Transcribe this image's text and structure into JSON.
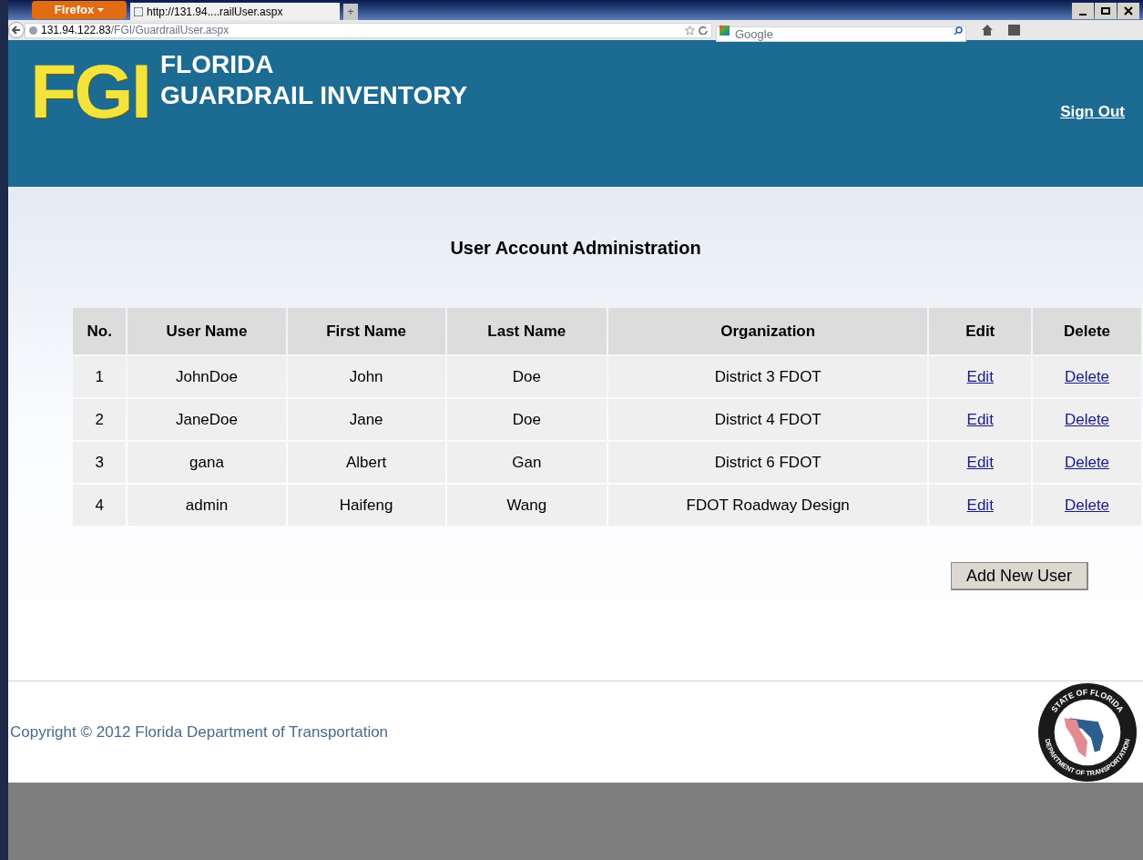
{
  "browser": {
    "menu_button": "Firefox",
    "tab": {
      "title": "http://131.94....railUser.aspx",
      "selected": true
    },
    "new_tab": "+",
    "address": {
      "host": "131.94.122.83",
      "path": "/FGI/GuardrailUser.aspx"
    },
    "search": {
      "placeholder": "Google"
    }
  },
  "header": {
    "logo": "FGI",
    "title_line_1": "FLORIDA",
    "title_line_2": "GUARDRAIL INVENTORY",
    "sign_out": "Sign Out"
  },
  "page_title": "User Account Administration",
  "table": {
    "columns": [
      "No.",
      "User Name",
      "First Name",
      "Last Name",
      "Organization",
      "Edit",
      "Delete"
    ],
    "rows": [
      {
        "no": "1",
        "user_name": "JohnDoe",
        "first_name": "John",
        "last_name": "Doe",
        "organization": "District 3 FDOT",
        "edit": "Edit",
        "delete": "Delete"
      },
      {
        "no": "2",
        "user_name": "JaneDoe",
        "first_name": "Jane",
        "last_name": "Doe",
        "organization": "District 4 FDOT",
        "edit": "Edit",
        "delete": "Delete"
      },
      {
        "no": "3",
        "user_name": "gana",
        "first_name": "Albert",
        "last_name": "Gan",
        "organization": "District 6 FDOT",
        "edit": "Edit",
        "delete": "Delete"
      },
      {
        "no": "4",
        "user_name": "admin",
        "first_name": "Haifeng",
        "last_name": "Wang",
        "organization": "FDOT Roadway Design",
        "edit": "Edit",
        "delete": "Delete"
      }
    ]
  },
  "add_button": "Add New User",
  "footer": {
    "copyright": "Copyright © 2012 Florida Department of Transportation",
    "seal_top": "STATE OF FLORIDA",
    "seal_bottom": "DEPARTMENT OF TRANSPORTATION"
  }
}
